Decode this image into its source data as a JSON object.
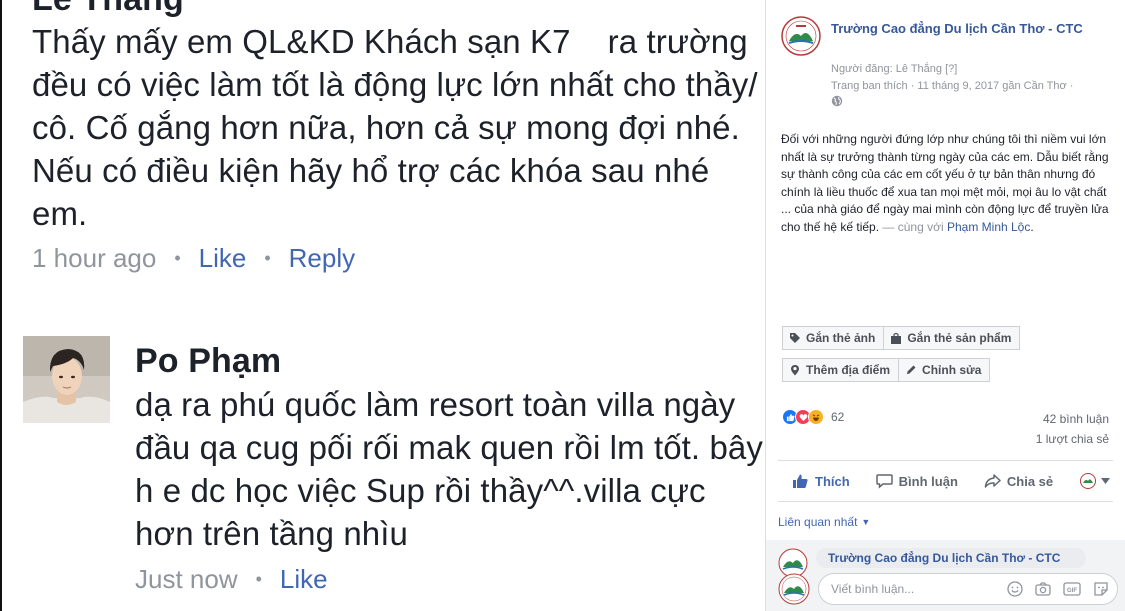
{
  "comment1": {
    "name_partial": "Lê Thắng",
    "text": "Thấy mấy em QL&KD Khách sạn K7    ra trường đều có việc làm tốt là động lực lớn nhất cho thầy/ cô. Cố gắng hơn nữa, hơn cả sự mong đợi nhé. Nếu có điều kiện hãy hổ trợ các khóa sau nhé em.",
    "time": "1 hour ago",
    "like_label": "Like",
    "reply_label": "Reply"
  },
  "comment2": {
    "name": "Po Phạm",
    "text": "dạ ra phú quốc làm resort toàn villa ngày đầu qa cug pối rối mak quen rồi lm tốt. bây h e dc học việc Sup rồi thầy^^.villa cực hơn trên tầng nhìu",
    "time": "Just now",
    "like_label": "Like"
  },
  "panel": {
    "page_name": "Trường Cao đẳng Du lịch Cần Thơ - CTC",
    "posted_by": "Người đăng: Lê Thắng",
    "posted_by_help": "[?]",
    "timeline_info": "Trang ban thích · 11 tháng 9, 2017 gần Cần Thơ ·",
    "caption": "Đối với những người đứng lớp như chúng tôi thì niềm vui lớn nhất là sự trưởng thành từng ngày của các em. Dẫu biết rằng sự thành công của các em cốt yếu ở tự bản thân nhưng đó chính là liều thuốc để xua tan mọi mệt mỏi, mọi âu lo vật chất ... của nhà giáo để ngày mai mình còn động lực để truyền lửa cho thế hệ kế tiếp.",
    "caption_with": " — cùng với ",
    "caption_tag": "Phạm Minh Lộc",
    "caption_end": ".",
    "tag_photo_label": "Gắn thẻ ảnh",
    "tag_product_label": "Gắn thẻ sản phẩm",
    "add_location_label": "Thêm địa điểm",
    "edit_label": "Chỉnh sửa",
    "reaction_count": "62",
    "comments_count": "42 bình luận",
    "shares_count": "1 lượt chia sẻ",
    "like_action": "Thích",
    "comment_action": "Bình luận",
    "share_action": "Chia sẻ",
    "related_label": "Liên quan nhất",
    "peek_name": "Trường Cao đẳng Du lịch Cần Thơ - CTC",
    "composer_placeholder": "Viết bình luận..."
  },
  "colors": {
    "fb_blue": "#4267b2",
    "link_blue": "#365899",
    "meta_grey": "#90949c",
    "like_blue": "#1877f2",
    "love_red": "#f33e58",
    "haha_yellow": "#f7b125"
  }
}
